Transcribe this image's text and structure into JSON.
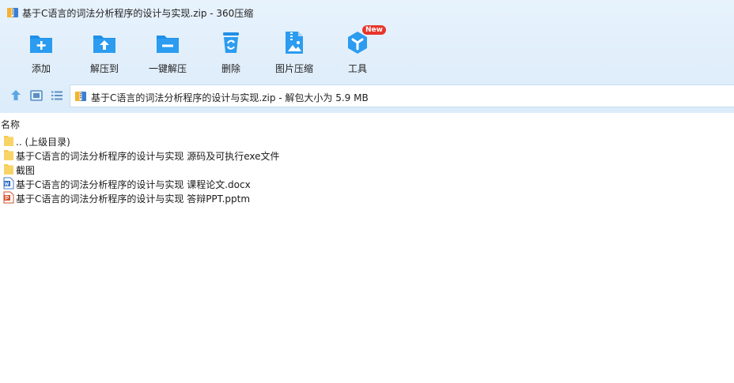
{
  "window": {
    "title": "基于C语言的词法分析程序的设计与实现.zip - 360压缩",
    "app_icon": "zip-archive-icon"
  },
  "toolbar": {
    "items": [
      {
        "label": "添加",
        "icon": "add-folder-icon"
      },
      {
        "label": "解压到",
        "icon": "extract-to-folder-icon"
      },
      {
        "label": "一键解压",
        "icon": "one-click-extract-icon"
      },
      {
        "label": "删除",
        "icon": "recycle-bin-icon"
      },
      {
        "label": "图片压缩",
        "icon": "image-compress-icon"
      },
      {
        "label": "工具",
        "icon": "tools-icon",
        "badge": "New"
      }
    ],
    "icon_color": "#1f8fe6"
  },
  "nav": {
    "up_icon": "up-arrow-icon",
    "view_icon": "thumbnail-view-icon",
    "list_icon": "list-view-icon",
    "address": "基于C语言的词法分析程序的设计与实现.zip - 解包大小为 5.9 MB"
  },
  "list": {
    "column_name": "名称",
    "rows": [
      {
        "name": ".. (上级目录)",
        "type": "folder"
      },
      {
        "name": "基于C语言的词法分析程序的设计与实现 源码及可执行exe文件",
        "type": "folder"
      },
      {
        "name": "截图",
        "type": "folder"
      },
      {
        "name": "基于C语言的词法分析程序的设计与实现  课程论文.docx",
        "type": "word"
      },
      {
        "name": "基于C语言的词法分析程序的设计与实现 答辩PPT.pptm",
        "type": "powerpoint"
      }
    ]
  },
  "colors": {
    "accent": "#1f8fe6",
    "toolbar_bg": "#e1eefb",
    "folder": "#f6c94e",
    "badge": "#e8352c"
  }
}
